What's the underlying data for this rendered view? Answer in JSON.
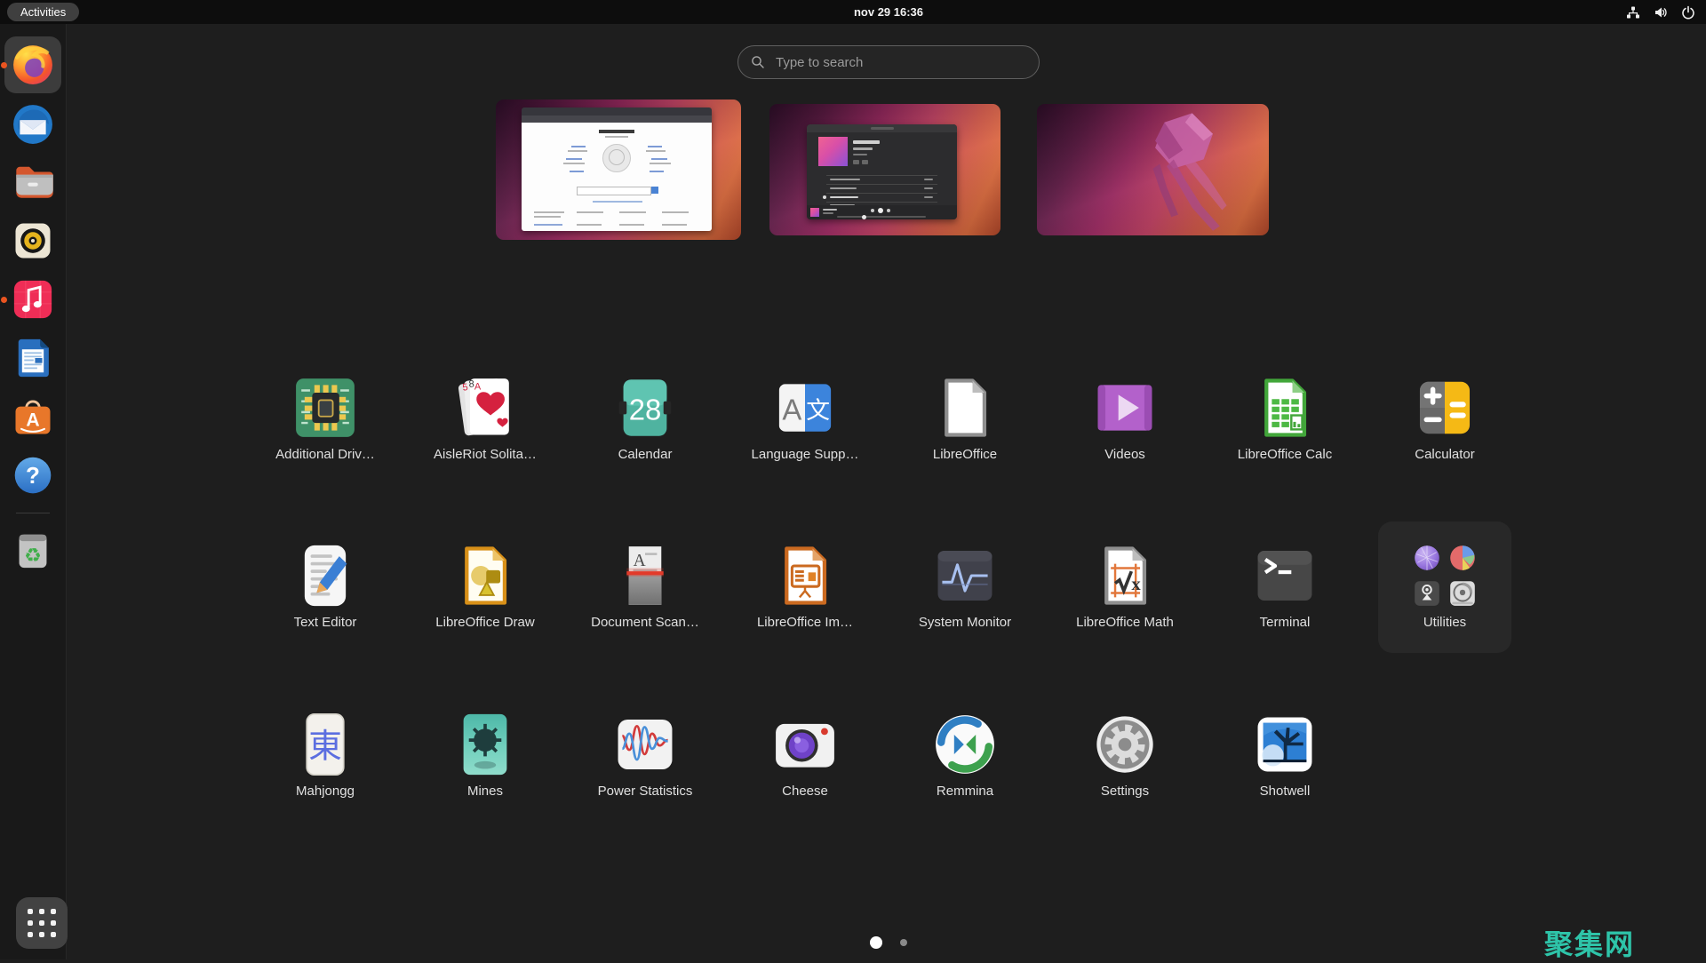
{
  "topbar": {
    "activities_label": "Activities",
    "clock": "nov 29  16:36",
    "status_icons": [
      {
        "id": "network",
        "name": "network-icon"
      },
      {
        "id": "volume",
        "name": "volume-icon"
      },
      {
        "id": "power",
        "name": "power-icon"
      }
    ]
  },
  "search": {
    "placeholder": "Type to search"
  },
  "workspaces": [
    {
      "id": "workspace-browser",
      "content": "firefox-wikipedia-window"
    },
    {
      "id": "workspace-music",
      "content": "music-player-window"
    },
    {
      "id": "workspace-empty",
      "content": "jellyfish-wallpaper"
    }
  ],
  "dock": {
    "items": [
      {
        "id": "firefox",
        "icon": "firefox-icon",
        "running": true,
        "active": true
      },
      {
        "id": "thunderbird",
        "icon": "thunderbird-icon",
        "running": false,
        "active": false
      },
      {
        "id": "files",
        "icon": "files-icon",
        "running": false,
        "active": false
      },
      {
        "id": "rhythmbox",
        "icon": "rhythmbox-icon",
        "running": false,
        "active": false
      },
      {
        "id": "music",
        "icon": "music-icon",
        "running": true,
        "active": false
      },
      {
        "id": "writer",
        "icon": "libreoffice-writer-icon",
        "running": false,
        "active": false
      },
      {
        "id": "software",
        "icon": "ubuntu-software-icon",
        "running": false,
        "active": false
      },
      {
        "id": "help",
        "icon": "help-icon",
        "running": false,
        "active": false
      },
      {
        "id": "trash",
        "icon": "trash-icon",
        "running": false,
        "active": false
      }
    ]
  },
  "app_grid": {
    "rows": [
      [
        {
          "label": "Additional Driv…",
          "icon": "additional-drivers"
        },
        {
          "label": "AisleRiot Solita…",
          "icon": "aisleriot"
        },
        {
          "label": "Calendar",
          "icon": "calendar"
        },
        {
          "label": "Language Supp…",
          "icon": "language-support"
        },
        {
          "label": "LibreOffice",
          "icon": "libreoffice"
        },
        {
          "label": "Videos",
          "icon": "videos"
        },
        {
          "label": "LibreOffice Calc",
          "icon": "libreoffice-calc"
        },
        {
          "label": "Calculator",
          "icon": "calculator"
        }
      ],
      [
        {
          "label": "Text Editor",
          "icon": "text-editor"
        },
        {
          "label": "LibreOffice Draw",
          "icon": "libreoffice-draw"
        },
        {
          "label": "Document Scan…",
          "icon": "document-scanner"
        },
        {
          "label": "LibreOffice Im…",
          "icon": "libreoffice-impress"
        },
        {
          "label": "System Monitor",
          "icon": "system-monitor"
        },
        {
          "label": "LibreOffice Math",
          "icon": "libreoffice-math"
        },
        {
          "label": "Terminal",
          "icon": "terminal"
        },
        {
          "label": "Utilities",
          "icon": "utilities-folder",
          "type": "folder",
          "mini_icons": [
            "peripherals",
            "disk-usage",
            "tool",
            "disks"
          ]
        }
      ],
      [
        {
          "label": "Mahjongg",
          "icon": "mahjongg"
        },
        {
          "label": "Mines",
          "icon": "mines"
        },
        {
          "label": "Power Statistics",
          "icon": "power-statistics"
        },
        {
          "label": "Cheese",
          "icon": "cheese"
        },
        {
          "label": "Remmina",
          "icon": "remmina"
        },
        {
          "label": "Settings",
          "icon": "settings"
        },
        {
          "label": "Shotwell",
          "icon": "shotwell"
        }
      ]
    ]
  },
  "pagination": {
    "dots": [
      {
        "active": true
      },
      {
        "active": false
      }
    ]
  },
  "watermark": {
    "text": "聚集网",
    "color": "#2ec4a9"
  },
  "colors": {
    "running_indicator": "#e95420",
    "background": "#1e1e1e",
    "topbar": "#0d0d0d",
    "dock": "#191919",
    "folder_tile": "#282828"
  }
}
